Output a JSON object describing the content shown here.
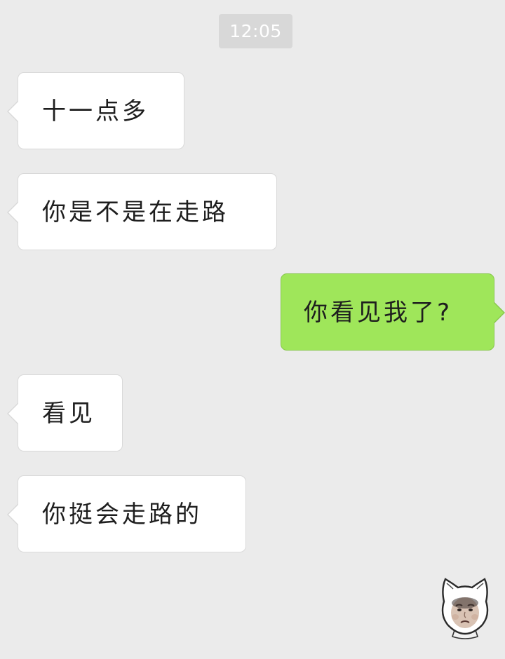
{
  "chat": {
    "timestamp": "12:05",
    "messages": [
      {
        "side": "incoming",
        "text": "十一点多"
      },
      {
        "side": "incoming",
        "text": "你是不是在走路"
      },
      {
        "side": "outgoing",
        "text": "你看见我了?"
      },
      {
        "side": "incoming",
        "text": "看见"
      },
      {
        "side": "incoming",
        "text": "你挺会走路的"
      }
    ],
    "sticker": {
      "icon": "sad-cat-face-sticker-icon"
    }
  },
  "colors": {
    "background": "#ebebeb",
    "incoming_bubble": "#ffffff",
    "outgoing_bubble": "#9fe65a",
    "timestamp_bg": "#d8d8d8",
    "timestamp_text": "#ffffff"
  }
}
